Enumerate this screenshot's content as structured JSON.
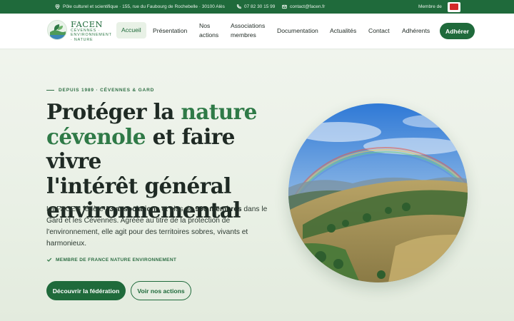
{
  "topbar": {
    "address": "Pôle culturel et scientifique · 155, rue du Faubourg de Rochebelle · 30100 Alès",
    "phone": "07 82 30 15 99",
    "email": "contact@facen.fr",
    "member_label": "Membre de"
  },
  "brand": {
    "name": "FACEN",
    "tagline_1": "CÉVENNES ·",
    "tagline_2": "ENVIRONNEMENT",
    "tagline_3": "· NATURE"
  },
  "nav": {
    "items": [
      {
        "label": "Accueil"
      },
      {
        "label": "Présentation"
      },
      {
        "label": "Nos",
        "label2": "actions"
      },
      {
        "label": "Associations",
        "label2": "membres"
      },
      {
        "label": "Documentation"
      },
      {
        "label": "Actualités"
      },
      {
        "label": "Contact"
      },
      {
        "label": "Adhérents"
      }
    ],
    "cta": "Adhérer"
  },
  "hero": {
    "eyebrow": "DEPUIS 1989 · CÉVENNES & GARD",
    "headline_1": "Protéger la ",
    "headline_accent_1": "nature",
    "headline_accent_2": "cévenole",
    "headline_2": " et faire vivre",
    "headline_3": "l'intérêt général",
    "headline_4": "environnemental",
    "lead_1": "La FACEN fédère ",
    "lead_b1": "13 associations",
    "lead_2": " et plus de ",
    "lead_b2": "900 membres",
    "lead_3": " dans le Gard et les Cévennes. Agréée au titre de la protection de l'environnement, elle agit pour des territoires sobres, vivants et harmonieux.",
    "badge": "MEMBRE DE FRANCE NATURE ENVIRONNEMENT",
    "btn_primary": "Découvrir la fédération",
    "btn_secondary": "Voir nos actions"
  },
  "colors": {
    "brand_green": "#1f6a3b",
    "accent_green": "#2f7a47",
    "fne_red": "#d42a2a"
  }
}
